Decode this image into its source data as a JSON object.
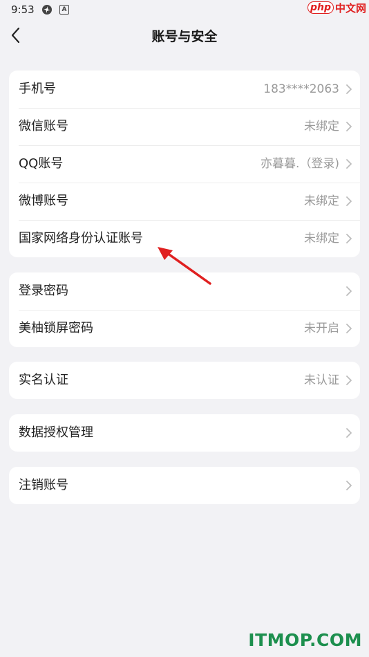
{
  "status_bar": {
    "time": "9:53",
    "icons": [
      "fan-icon",
      "a-icon"
    ]
  },
  "watermark_top": {
    "brand": "php",
    "text": "中文网"
  },
  "header": {
    "title": "账号与安全",
    "back_icon": "chevron-left-icon"
  },
  "groups": [
    {
      "rows": [
        {
          "label": "手机号",
          "value": "183****2063"
        },
        {
          "label": "微信账号",
          "value": "未绑定"
        },
        {
          "label": "QQ账号",
          "value": "亦暮暮.（登录)"
        },
        {
          "label": "微博账号",
          "value": "未绑定"
        },
        {
          "label": "国家网络身份认证账号",
          "value": "未绑定"
        }
      ]
    },
    {
      "rows": [
        {
          "label": "登录密码",
          "value": ""
        },
        {
          "label": "美柚锁屏密码",
          "value": "未开启"
        }
      ]
    },
    {
      "rows": [
        {
          "label": "实名认证",
          "value": "未认证"
        }
      ]
    },
    {
      "rows": [
        {
          "label": "数据授权管理",
          "value": ""
        }
      ]
    },
    {
      "rows": [
        {
          "label": "注销账号",
          "value": ""
        }
      ]
    }
  ],
  "annotation": {
    "color": "#e02020"
  },
  "watermark_bottom": {
    "text": "ITMOP.COM",
    "color": "#1d8f4e"
  }
}
